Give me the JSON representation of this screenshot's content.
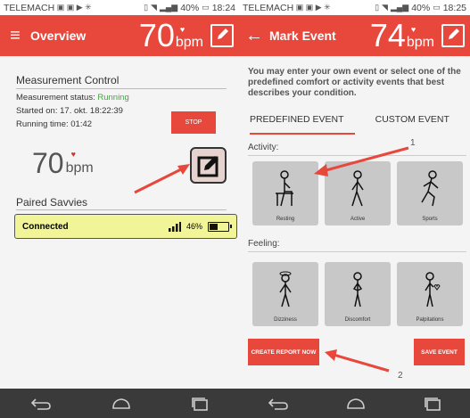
{
  "left": {
    "status": {
      "carrier": "TELEMACH",
      "battery": "40%",
      "time": "18:24"
    },
    "appbar": {
      "title": "Overview",
      "hr_value": "70",
      "hr_unit": "bpm"
    },
    "measurement": {
      "title": "Measurement Control",
      "status_label": "Measurement status:",
      "status_value": "Running",
      "started_label": "Started on:",
      "started_value": "17. okt. 18:22:39",
      "running_label": "Running time:",
      "running_value": "01:42",
      "stop_label": "STOP",
      "hr_value": "70",
      "hr_unit": "bpm"
    },
    "paired": {
      "title": "Paired Savvies",
      "device_status": "Connected",
      "battery_percent": "46%",
      "battery_level": 0.46
    }
  },
  "right": {
    "status": {
      "carrier": "TELEMACH",
      "battery": "40%",
      "time": "18:25"
    },
    "appbar": {
      "title": "Mark Event",
      "hr_value": "74",
      "hr_unit": "bpm"
    },
    "intro": "You may enter your own event or select one of the predefined comfort or activity events that best describes your condition.",
    "tabs": [
      "PREDEFINED EVENT",
      "CUSTOM EVENT"
    ],
    "activity_label": "Activity:",
    "activity_items": [
      "Resting",
      "Active",
      "Sports"
    ],
    "feeling_label": "Feeling:",
    "feeling_items": [
      "Dizziness",
      "Discomfort",
      "Palpitations"
    ],
    "create_report_label": "CREATE REPORT NOW",
    "save_event_label": "SAVE EVENT"
  },
  "annotations": {
    "callout_1": "1",
    "callout_2": "2"
  },
  "colors": {
    "accent": "#e8473c",
    "running": "#4aa04a",
    "device_bg": "#f2f597",
    "tile_bg": "#c8c8c8",
    "navbar": "#3a3a3a"
  }
}
